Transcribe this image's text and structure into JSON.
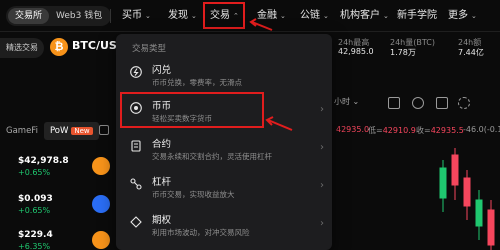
{
  "topnav": {
    "segment": [
      "交易所",
      "Web3 钱包"
    ],
    "items": [
      "买币",
      "发现",
      "交易",
      "金融",
      "公链",
      "机构客户",
      "新手学院",
      "更多"
    ]
  },
  "ticker": {
    "pill": "精选交易",
    "pair": "BTC/USD",
    "stats": [
      {
        "label": "24h最高",
        "value": "42,985.0"
      },
      {
        "label": "24h量(BTC)",
        "value": "1.78万"
      },
      {
        "label": "24h额",
        "value": "7.44亿"
      }
    ]
  },
  "market": {
    "tabs": [
      "GameFi",
      "PoW",
      "New"
    ],
    "rows": [
      {
        "price": "$42,978.8",
        "change": "+0.65%",
        "color": "#f7931a"
      },
      {
        "price": "$0.093",
        "change": "+0.65%",
        "color": "#2a6df4"
      },
      {
        "price": "$229.4",
        "change": "+6.35%",
        "color": "#f7931a"
      }
    ]
  },
  "chart": {
    "timeframe": "小时",
    "ohlc": [
      {
        "label": "",
        "value": "42935.0",
        "cls": "red"
      },
      {
        "label": "低=",
        "value": "42910.9",
        "cls": "red"
      },
      {
        "label": "收=",
        "value": "42935.5",
        "cls": "red"
      },
      {
        "label": "-46.0",
        "value": "(-0.1",
        "cls": "gry"
      }
    ]
  },
  "dropdown": {
    "title": "交易类型",
    "items": [
      {
        "label": "闪兑",
        "desc": "币币兑换，零费率，无滑点",
        "icon": "lightning-icon"
      },
      {
        "label": "币币",
        "desc": "轻松买卖数字货币",
        "icon": "swap-icon"
      },
      {
        "label": "合约",
        "desc": "交易永续和交割合约，灵活使用杠杆",
        "icon": "contract-icon"
      },
      {
        "label": "杠杆",
        "desc": "币币交易，实现收益放大",
        "icon": "leverage-icon"
      },
      {
        "label": "期权",
        "desc": "利用市场波动，对冲交易风险",
        "icon": "options-icon"
      }
    ]
  }
}
